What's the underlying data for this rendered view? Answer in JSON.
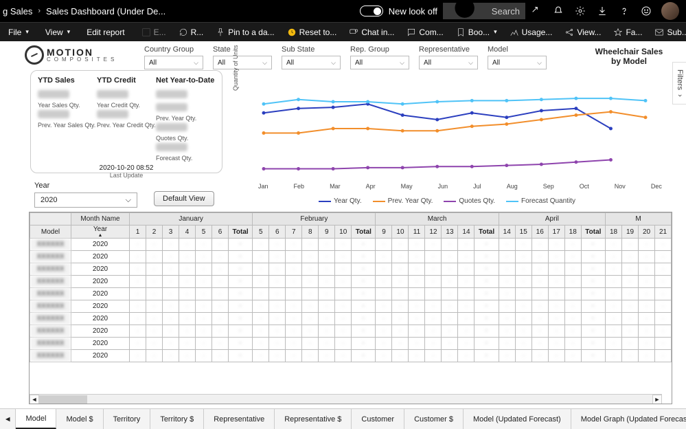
{
  "header": {
    "breadcrumb": [
      "g Sales",
      "Sales Dashboard (Under De..."
    ],
    "toggle_label": "New look off",
    "search_placeholder": "Search"
  },
  "ribbon": {
    "file": "File",
    "view": "View",
    "edit": "Edit report",
    "items": [
      "E...",
      "R...",
      "Pin to a da...",
      "Reset to...",
      "Chat in...",
      "Com...",
      "Boo...",
      "Usage...",
      "View...",
      "Fa...",
      "Sub..."
    ]
  },
  "logo": {
    "line1": "MOTION",
    "line2": "COMPOSITES"
  },
  "report_title": "Wheelchair Sales by Model",
  "slicers": [
    {
      "label": "Country Group",
      "value": "All"
    },
    {
      "label": "State",
      "value": "All"
    },
    {
      "label": "Sub State",
      "value": "All"
    },
    {
      "label": "Rep. Group",
      "value": "All"
    },
    {
      "label": "Representative",
      "value": "All"
    },
    {
      "label": "Model",
      "value": "All"
    }
  ],
  "kpi": {
    "cols": [
      {
        "title": "YTD Sales",
        "sub1": "Year Sales Qty.",
        "sub2": "Prev. Year Sales Qty."
      },
      {
        "title": "YTD Credit",
        "sub1": "Year Credit Qty.",
        "sub2": "Prev. Year Credit Qty."
      },
      {
        "title": "Net Year-to-Date",
        "sub1": "Prev. Year Qty.",
        "sub2": "Quotes Qty.",
        "sub3": "Forecast Qty."
      }
    ],
    "timestamp": "2020-10-20 08:52",
    "timestamp_label": "Last Update"
  },
  "year": {
    "label": "Year",
    "value": "2020"
  },
  "default_view_btn": "Default View",
  "chart_data": {
    "type": "line",
    "ylabel": "Quantity of Units",
    "categories": [
      "Jan",
      "Feb",
      "Mar",
      "Apr",
      "May",
      "Jun",
      "Jul",
      "Aug",
      "Sep",
      "Oct",
      "Nov",
      "Dec"
    ],
    "series": [
      {
        "name": "Year Qty.",
        "color": "#2b3fbf",
        "values": [
          54,
          58,
          59,
          62,
          52,
          48,
          54,
          50,
          56,
          58,
          40,
          null
        ]
      },
      {
        "name": "Prev. Year Qty.",
        "color": "#f28e2b",
        "values": [
          36,
          36,
          40,
          40,
          38,
          38,
          42,
          44,
          48,
          52,
          55,
          50
        ]
      },
      {
        "name": "Quotes Qty.",
        "color": "#8e44ad",
        "values": [
          4,
          4,
          4,
          5,
          5,
          6,
          6,
          7,
          8,
          10,
          12,
          null
        ]
      },
      {
        "name": "Forecast Quantity",
        "color": "#4fc3f7",
        "values": [
          62,
          66,
          64,
          64,
          62,
          64,
          65,
          65,
          66,
          67,
          67,
          65
        ]
      }
    ],
    "ylim": [
      0,
      80
    ]
  },
  "matrix": {
    "header1": "Month Name",
    "header0": "Model",
    "header_year": "Year",
    "months": [
      "January",
      "February",
      "March",
      "April",
      "M"
    ],
    "weeks": [
      [
        1,
        2,
        3,
        4,
        5,
        6
      ],
      [
        5,
        6,
        7,
        8,
        9,
        10
      ],
      [
        9,
        10,
        11,
        12,
        13,
        14
      ],
      [
        14,
        15,
        16,
        17,
        18
      ],
      [
        18,
        19,
        20,
        21
      ]
    ],
    "total": "Total",
    "year_value": "2020",
    "row_count": 10
  },
  "tabs": [
    "Model",
    "Model $",
    "Territory",
    "Territory $",
    "Representative",
    "Representative $",
    "Customer",
    "Customer $",
    "Model (Updated Forecast)",
    "Model Graph (Updated Forecast)"
  ],
  "filters_label": "Filters"
}
